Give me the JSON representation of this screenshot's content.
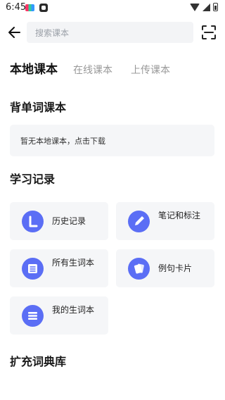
{
  "status_bar": {
    "time": "6:45"
  },
  "search": {
    "placeholder": "搜索课本"
  },
  "tabs": [
    {
      "label": "本地课本",
      "active": true
    },
    {
      "label": "在线课本",
      "active": false
    },
    {
      "label": "上传课本",
      "active": false
    }
  ],
  "sections": {
    "vocab_books": {
      "title": "背单词课本",
      "empty_message": "暂无本地课本，点击下载"
    },
    "study_records": {
      "title": "学习记录"
    },
    "expand": {
      "title": "扩充词典库"
    }
  },
  "records": [
    {
      "label": "历史记录",
      "icon": "history-icon"
    },
    {
      "label": "笔记和标注",
      "icon": "pencil-icon"
    },
    {
      "label": "所有生词本",
      "icon": "notebook-icon"
    },
    {
      "label": "例句卡片",
      "icon": "cards-icon"
    },
    {
      "label": "我的生词本",
      "icon": "list-icon"
    }
  ],
  "colors": {
    "accent": "#5b6ef5",
    "card_bg": "#f5f6f8",
    "search_bg": "#f3f4f6"
  }
}
